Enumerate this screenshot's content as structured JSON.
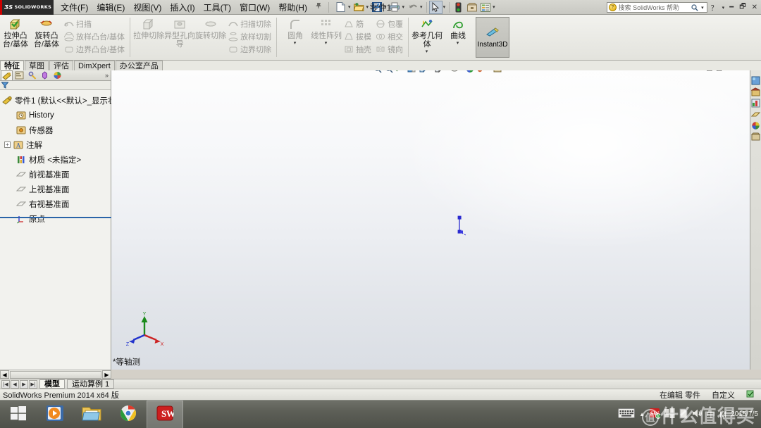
{
  "titlebar": {
    "logo_text": "SOLIDWORKS",
    "menus": [
      {
        "label": "文件(F)"
      },
      {
        "label": "编辑(E)"
      },
      {
        "label": "视图(V)"
      },
      {
        "label": "插入(I)"
      },
      {
        "label": "工具(T)"
      },
      {
        "label": "窗口(W)"
      },
      {
        "label": "帮助(H)"
      }
    ],
    "pin_icon": "pushpin-icon",
    "quick_access": [
      {
        "name": "new-document-icon",
        "has_caret": true
      },
      {
        "name": "open-document-icon",
        "has_caret": true
      },
      {
        "name": "save-icon",
        "has_caret": true
      },
      {
        "name": "print-icon",
        "has_caret": true
      },
      {
        "name": "undo-icon",
        "has_caret": true
      },
      {
        "name": "select-arrow-icon",
        "has_caret": true,
        "pressed": true
      },
      {
        "name": "rebuild-icon",
        "has_caret": false
      },
      {
        "name": "options-icon",
        "has_caret": false
      },
      {
        "name": "document-properties-icon",
        "has_caret": true
      }
    ],
    "document_title": "零件1",
    "search_placeholder": "搜索 SolidWorks 帮助",
    "help_caret": "?",
    "window_buttons": [
      "minimize",
      "restore",
      "close"
    ]
  },
  "ribbon": {
    "groups": [
      {
        "big": [
          {
            "label": "拉伸凸台/基体",
            "icon": "extrude-boss-icon",
            "disabled": false
          },
          {
            "label": "旋转凸台/基体",
            "icon": "revolve-boss-icon",
            "disabled": false
          }
        ],
        "small": [
          {
            "label": "扫描",
            "icon": "sweep-icon",
            "disabled": true
          },
          {
            "label": "放样凸台/基体",
            "icon": "loft-icon",
            "disabled": true
          },
          {
            "label": "边界凸台/基体",
            "icon": "boundary-icon",
            "disabled": true
          }
        ]
      },
      {
        "big": [
          {
            "label": "拉伸切除",
            "icon": "extrude-cut-icon",
            "disabled": true
          },
          {
            "label": "异型孔向导",
            "icon": "hole-wizard-icon",
            "disabled": true
          },
          {
            "label": "旋转切除",
            "icon": "revolve-cut-icon",
            "disabled": true
          }
        ],
        "small": [
          {
            "label": "扫描切除",
            "icon": "sweep-cut-icon",
            "disabled": true
          },
          {
            "label": "放样切割",
            "icon": "loft-cut-icon",
            "disabled": true
          },
          {
            "label": "边界切除",
            "icon": "boundary-cut-icon",
            "disabled": true
          }
        ]
      },
      {
        "big": [
          {
            "label": "圆角",
            "icon": "fillet-icon",
            "disabled": true,
            "caret": true
          },
          {
            "label": "线性阵列",
            "icon": "linear-pattern-icon",
            "disabled": true,
            "caret": true
          }
        ],
        "small": [
          {
            "label": "筋",
            "icon": "rib-icon",
            "disabled": true
          },
          {
            "label": "拔模",
            "icon": "draft-icon",
            "disabled": true
          },
          {
            "label": "抽壳",
            "icon": "shell-icon",
            "disabled": true
          }
        ],
        "small2": [
          {
            "label": "包覆",
            "icon": "wrap-icon",
            "disabled": true
          },
          {
            "label": "相交",
            "icon": "intersect-icon",
            "disabled": true
          },
          {
            "label": "镜向",
            "icon": "mirror-icon",
            "disabled": true
          }
        ]
      },
      {
        "big": [
          {
            "label": "参考几何体",
            "icon": "reference-geometry-icon",
            "disabled": false,
            "caret": true
          },
          {
            "label": "曲线",
            "icon": "curves-icon",
            "disabled": false,
            "caret": true
          }
        ]
      }
    ],
    "instant3d": {
      "label": "Instant3D",
      "icon": "instant3d-icon",
      "active": true
    }
  },
  "command_tabs": [
    {
      "label": "特征",
      "active": true
    },
    {
      "label": "草图",
      "active": false
    },
    {
      "label": "评估",
      "active": false
    },
    {
      "label": "DimXpert",
      "active": false
    },
    {
      "label": "办公室产品",
      "active": false
    }
  ],
  "feature_manager": {
    "tabs": [
      {
        "name": "feature-tree-tab",
        "active": true
      },
      {
        "name": "property-manager-tab",
        "active": false
      },
      {
        "name": "configuration-manager-tab",
        "active": false
      },
      {
        "name": "dimxpert-manager-tab",
        "active": false
      },
      {
        "name": "display-manager-tab",
        "active": false
      }
    ],
    "expand_icon": "»",
    "filter_icon": "filter-icon",
    "tree": [
      {
        "label": "零件1  (默认<<默认>_显示状态",
        "icon": "part-icon",
        "indent": 0,
        "expander": ""
      },
      {
        "label": "History",
        "icon": "history-icon",
        "indent": 1,
        "expander": ""
      },
      {
        "label": "传感器",
        "icon": "sensors-icon",
        "indent": 1,
        "expander": ""
      },
      {
        "label": "注解",
        "icon": "annotations-icon",
        "indent": 1,
        "expander": "+"
      },
      {
        "label": "材质 <未指定>",
        "icon": "material-icon",
        "indent": 1,
        "expander": ""
      },
      {
        "label": "前视基准面",
        "icon": "plane-icon",
        "indent": 1,
        "expander": ""
      },
      {
        "label": "上视基准面",
        "icon": "plane-icon",
        "indent": 1,
        "expander": ""
      },
      {
        "label": "右视基准面",
        "icon": "plane-icon",
        "indent": 1,
        "expander": ""
      },
      {
        "label": "原点",
        "icon": "origin-icon",
        "indent": 1,
        "expander": ""
      }
    ]
  },
  "viewport": {
    "hud_buttons": [
      {
        "name": "zoom-to-fit-icon",
        "caret": false
      },
      {
        "name": "zoom-to-area-icon",
        "caret": false
      },
      {
        "name": "previous-view-icon",
        "caret": false
      },
      {
        "name": "section-view-icon",
        "caret": false
      },
      {
        "name": "view-orientation-icon",
        "caret": true
      },
      {
        "name": "display-style-icon",
        "caret": true
      },
      {
        "name": "hide-show-items-icon",
        "caret": true
      },
      {
        "name": "edit-appearance-icon",
        "caret": false
      },
      {
        "name": "apply-scene-icon",
        "caret": true
      },
      {
        "name": "view-settings-icon",
        "caret": true
      }
    ],
    "doc_window_buttons": [
      "restore-all",
      "tile",
      "minimize",
      "restore",
      "close"
    ],
    "view_label": "*等轴测",
    "triad": {
      "x_label": "X",
      "y_label": "Y",
      "z_label": "Z",
      "x_color": "#cc2222",
      "y_color": "#1a8a1a",
      "z_color": "#2233cc"
    },
    "origin_color": "#2a2ad0"
  },
  "task_pane": [
    {
      "name": "solidworks-resources-tab"
    },
    {
      "name": "design-library-tab"
    },
    {
      "name": "file-explorer-tab"
    },
    {
      "name": "view-palette-tab"
    },
    {
      "name": "appearances-scenes-tab"
    },
    {
      "name": "custom-properties-tab"
    }
  ],
  "bottom": {
    "nav_buttons": [
      "|◀",
      "◀",
      "▶",
      "▶|"
    ],
    "tabs": [
      {
        "label": "模型",
        "active": true
      },
      {
        "label": "运动算例 1",
        "active": false
      }
    ]
  },
  "statusbar": {
    "left": "SolidWorks Premium 2014 x64 版",
    "editing": "在编辑 零件",
    "custom": "自定义",
    "overlay_icon": "units-icon"
  },
  "taskbar": {
    "items": [
      {
        "name": "start-button",
        "icon": "windows-logo-icon"
      },
      {
        "name": "media-player-button",
        "icon": "media-player-icon"
      },
      {
        "name": "file-explorer-button",
        "icon": "folder-icon"
      },
      {
        "name": "chrome-button",
        "icon": "chrome-icon"
      },
      {
        "name": "solidworks-button",
        "icon": "solidworks-icon",
        "running": true
      }
    ],
    "tray": {
      "keyboard_icon": "keyboard-icon",
      "expand_icon": "▲",
      "sw_tray_icon": "solidworks-tray-icon",
      "win_icon": "windows-tray-icon",
      "doc_icon": "document-tray-icon",
      "speaker_icon": "speaker-icon",
      "ime_label": "中",
      "ime_label2": "M",
      "date": "2015/7/5"
    },
    "watermark": "什么值得买",
    "watermark_badge": "值"
  }
}
